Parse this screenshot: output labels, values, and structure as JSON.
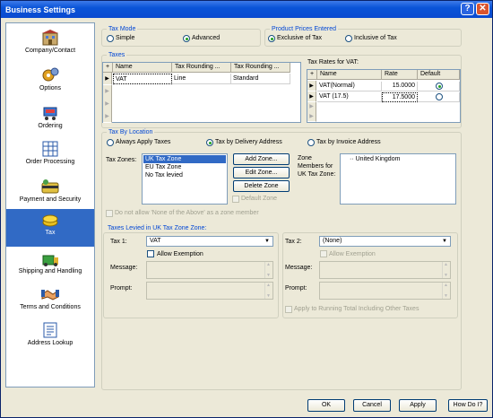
{
  "window": {
    "title": "Business Settings",
    "help_glyph": "?",
    "close_glyph": "✕"
  },
  "sidebar": {
    "items": [
      {
        "label": "Company/Contact",
        "icon": "building-icon"
      },
      {
        "label": "Options",
        "icon": "gears-icon"
      },
      {
        "label": "Ordering",
        "icon": "shopping-cart-icon"
      },
      {
        "label": "Order Processing",
        "icon": "spreadsheet-icon"
      },
      {
        "label": "Payment and Security",
        "icon": "credit-card-icon"
      },
      {
        "label": "Tax",
        "icon": "coins-icon",
        "selected": true
      },
      {
        "label": "Shipping and Handling",
        "icon": "shipping-box-icon"
      },
      {
        "label": "Terms and Conditions",
        "icon": "handshake-icon"
      },
      {
        "label": "Address Lookup",
        "icon": "address-book-icon"
      }
    ]
  },
  "tax_mode": {
    "label": "Tax Mode",
    "simple": "Simple",
    "advanced": "Advanced",
    "selected": "advanced"
  },
  "prices": {
    "label": "Product Prices Entered",
    "exclusive": "Exclusive of Tax",
    "inclusive": "Inclusive of Tax",
    "selected": "exclusive"
  },
  "taxes": {
    "label": "Taxes",
    "columns": [
      "Name",
      "Tax Rounding ...",
      "Tax Rounding ..."
    ],
    "rows": [
      [
        "VAT",
        "Line",
        "Standard"
      ]
    ]
  },
  "rates": {
    "label": "Tax Rates for VAT:",
    "columns": [
      "Name",
      "Rate",
      "Default"
    ],
    "rows": [
      {
        "name": "VAT(Normal)",
        "rate": "15.0000",
        "default": true
      },
      {
        "name": "VAT (17.5)",
        "rate": "17.5000",
        "default": false
      }
    ]
  },
  "location": {
    "label": "Tax By Location",
    "always": "Always Apply Taxes",
    "delivery": "Tax by Delivery Address",
    "invoice": "Tax by Invoice Address",
    "selected": "delivery",
    "zones_label": "Tax Zones:",
    "zones": [
      "UK Tax Zone",
      "EU Tax Zone",
      "No Tax levied"
    ],
    "add": "Add Zone...",
    "edit": "Edit Zone...",
    "delete": "Delete Zone",
    "default_zone": "Default Zone",
    "members_label": "Zone Members for UK Tax Zone:",
    "members": [
      "United Kingdom"
    ],
    "no_none": "Do not allow 'None of the Above' as a zone member"
  },
  "levied": {
    "label": "Taxes Levied in UK Tax Zone Zone:",
    "tax1": "Tax 1:",
    "tax1_value": "VAT",
    "tax2": "Tax 2:",
    "tax2_value": "(None)",
    "allow_exemption": "Allow Exemption",
    "message": "Message:",
    "prompt": "Prompt:",
    "apply_running": "Apply to Running Total Including Other Taxes"
  },
  "buttons": {
    "ok": "OK",
    "cancel": "Cancel",
    "apply": "Apply",
    "how": "How Do I?"
  }
}
